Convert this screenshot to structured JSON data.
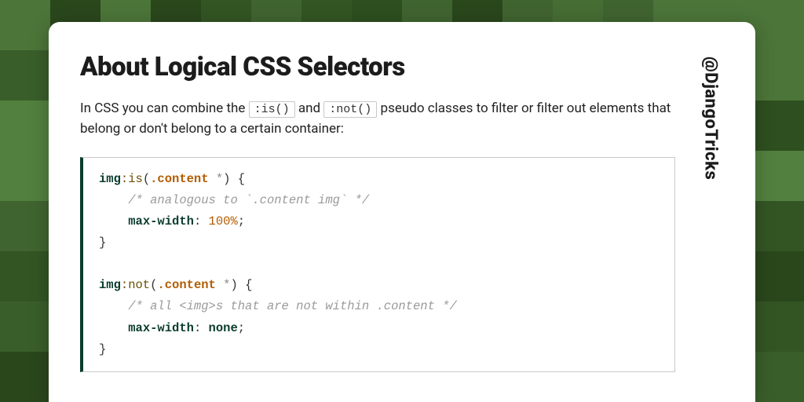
{
  "title": "About Logical CSS Selectors",
  "intro": {
    "part1": "In CSS you can combine the ",
    "code1": ":is()",
    "part2": " and ",
    "code2": ":not()",
    "part3": " pseudo classes to filter or filter out elements that belong or don't belong to a certain container:"
  },
  "code": {
    "block1": {
      "tag": "img",
      "pseudo": ":is",
      "open_paren": "(",
      "cls": ".content",
      "star": " *",
      "close_paren": ")",
      "space_brace": " {",
      "indent": "    ",
      "comment": "/* analogous to `.content img` */",
      "prop": "max-width",
      "colon": ": ",
      "num": "100",
      "unit": "%",
      "semi": ";",
      "close_brace": "}"
    },
    "block2": {
      "tag": "img",
      "pseudo": ":not",
      "open_paren": "(",
      "cls": ".content",
      "star": " *",
      "close_paren": ")",
      "space_brace": " {",
      "indent": "    ",
      "comment": "/* all <img>s that are not within .content */",
      "prop": "max-width",
      "colon": ": ",
      "val": "none",
      "semi": ";",
      "close_brace": "}"
    }
  },
  "handle": "@DjangoTricks",
  "colors": {
    "bg_shades": [
      "#2e4f1f",
      "#3a5e2a",
      "#466d34",
      "#52803e",
      "#335524",
      "#406430",
      "#2a471c",
      "#4c7539"
    ]
  }
}
